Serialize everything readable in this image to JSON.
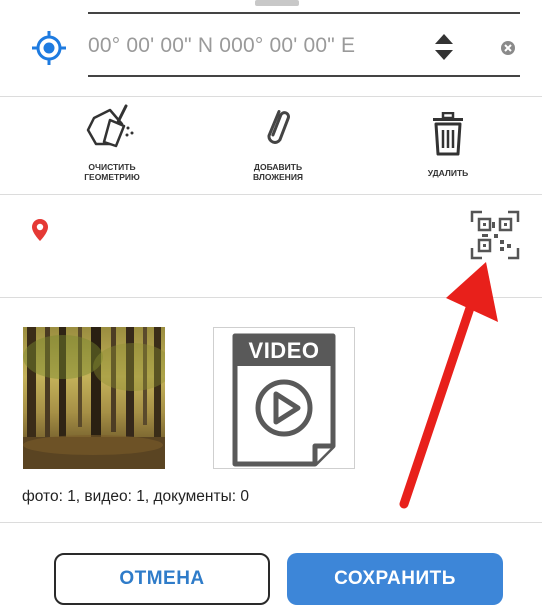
{
  "coordinates": {
    "value": "00° 00' 00\" N 000° 00' 00\" E"
  },
  "tools": [
    {
      "label_line1": "ОЧИСТИТЬ",
      "label_line2": "ГЕОМЕТРИЮ",
      "icon": "clear-geometry-icon"
    },
    {
      "label_line1": "ДОБАВИТЬ",
      "label_line2": "ВЛОЖЕНИЯ",
      "icon": "paperclip-icon"
    },
    {
      "label_line1": "УДАЛИТЬ",
      "label_line2": "",
      "icon": "trash-icon"
    }
  ],
  "attachments": {
    "video_label": "VIDEO",
    "counts_text": "фото: 1, видео: 1, документы: 0"
  },
  "buttons": {
    "cancel": "ОТМЕНА",
    "save": "СОХРАНИТЬ"
  },
  "colors": {
    "accent": "#3d86d8",
    "location_red": "#e53935",
    "arrow_red": "#e8201b"
  }
}
